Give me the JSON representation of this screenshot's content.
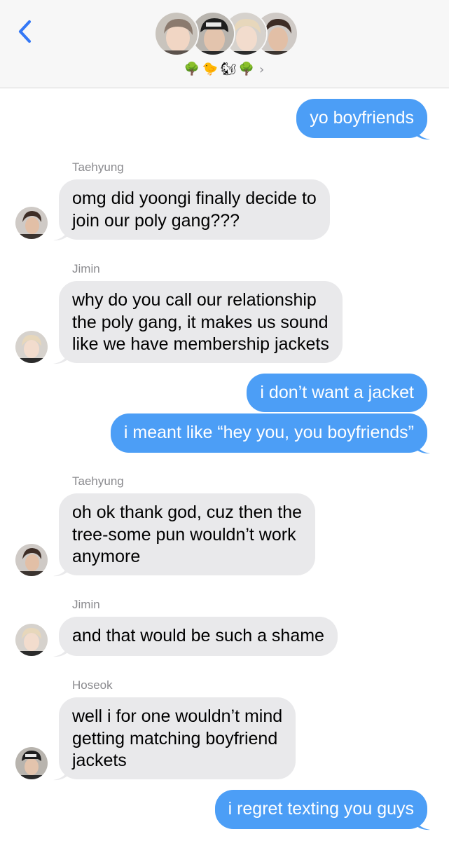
{
  "header": {
    "back_icon": "chevron-left-icon",
    "back_color": "#3478f6",
    "group_emojis": [
      "🌳",
      "🐤",
      "🐿",
      "🌳"
    ],
    "group_chevron": "›"
  },
  "colors": {
    "outgoing_bubble": "#4c9ef6",
    "incoming_bubble": "#e9e9eb",
    "sender_name": "#8a8a8e"
  },
  "messages": [
    {
      "direction": "outgoing",
      "text": "yo boyfriends"
    },
    {
      "direction": "incoming",
      "sender": "Taehyung",
      "lines": [
        "omg did yoongi finally decide to",
        "join our poly gang???"
      ]
    },
    {
      "direction": "incoming",
      "sender": "Jimin",
      "lines": [
        "why do you call our relationship",
        "the poly gang, it makes us sound",
        "like we have membership jackets"
      ]
    },
    {
      "direction": "outgoing",
      "text": "i don’t want a jacket"
    },
    {
      "direction": "outgoing",
      "text": "i meant like “hey you, you boyfriends”"
    },
    {
      "direction": "incoming",
      "sender": "Taehyung",
      "lines": [
        "oh ok thank god, cuz then the",
        "tree-some pun wouldn’t work",
        "anymore"
      ]
    },
    {
      "direction": "incoming",
      "sender": "Jimin",
      "lines": [
        "and that would be such a shame"
      ]
    },
    {
      "direction": "incoming",
      "sender": "Hoseok",
      "lines": [
        "well i for one wouldn’t mind",
        "getting matching boyfriend",
        "jackets"
      ]
    },
    {
      "direction": "outgoing",
      "text": "i regret texting you guys"
    }
  ]
}
